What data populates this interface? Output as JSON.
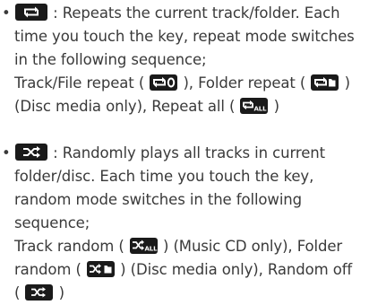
{
  "repeat_section": {
    "bullet": "•",
    "key_icon": "repeat-icon",
    "line1_rest": " : Repeats the current track/folder. Each",
    "line2": "time you touch the key, repeat mode switches",
    "line3": "in the following sequence;",
    "line4_a": "Track/File repeat ( ",
    "line4_track_icon": "repeat-one-icon",
    "line4_b": " ), Folder repeat ( ",
    "line4_folder_icon": "repeat-folder-icon",
    "line4_c": " )",
    "line5_a": "(Disc media only), Repeat all ( ",
    "line5_all_icon": "repeat-all-icon",
    "line5_b": " )"
  },
  "random_section": {
    "bullet": "•",
    "key_icon": "shuffle-icon",
    "line1_rest": " : Randomly plays all tracks in current",
    "line2": "folder/disc. Each time you touch the key,",
    "line3": "random mode switches in the following",
    "line4": "sequence;",
    "line5_a": "Track random ( ",
    "line5_track_icon": "shuffle-all-icon",
    "line5_b": " ) (Music CD only), Folder",
    "line6_a": "random ( ",
    "line6_folder_icon": "shuffle-folder-icon",
    "line6_b": " ) (Disc media only), Random off",
    "line7_a": "( ",
    "line7_off_icon": "shuffle-off-icon",
    "line7_b": " )"
  },
  "icon_text": {
    "all": "ALL"
  },
  "colors": {
    "text": "#3a3a3a",
    "key_background": "#1a1a1a",
    "key_glyph": "#ffffff"
  }
}
